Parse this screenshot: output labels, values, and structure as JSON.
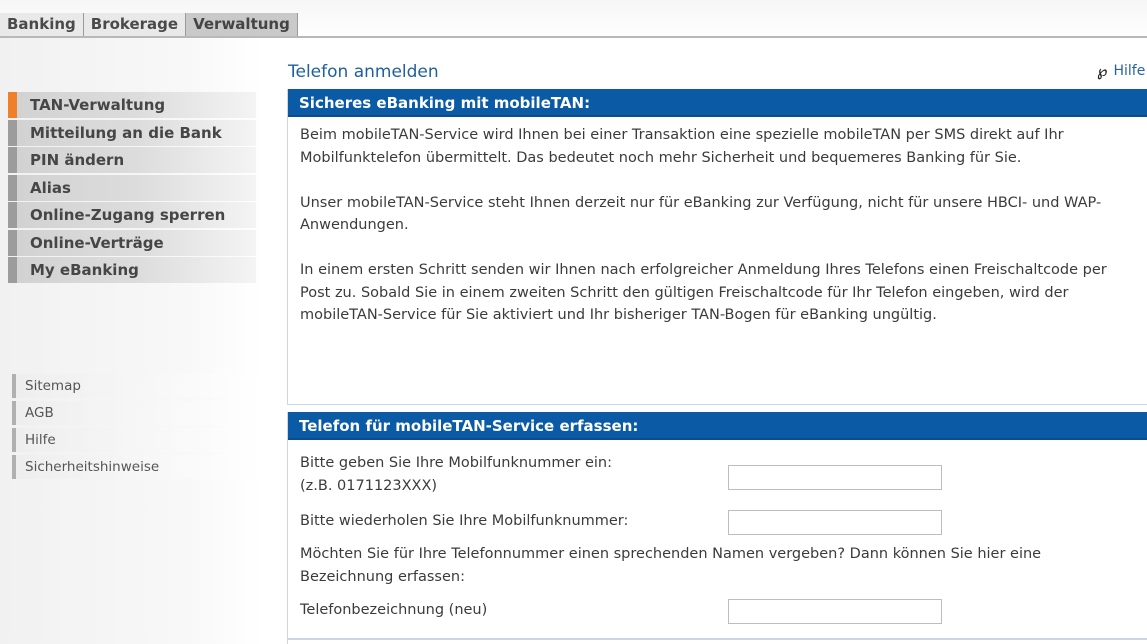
{
  "tabs": [
    {
      "label": "Banking"
    },
    {
      "label": "Brokerage"
    },
    {
      "label": "Verwaltung",
      "active": true
    }
  ],
  "sidebar": {
    "nav": [
      {
        "label": "TAN-Verwaltung",
        "active": true
      },
      {
        "label": "Mitteilung an die Bank"
      },
      {
        "label": "PIN ändern"
      },
      {
        "label": "Alias"
      },
      {
        "label": "Online-Zugang sperren"
      },
      {
        "label": "Online-Verträge"
      },
      {
        "label": "My eBanking"
      }
    ],
    "utility": [
      {
        "label": "Sitemap"
      },
      {
        "label": "AGB"
      },
      {
        "label": "Hilfe"
      },
      {
        "label": "Sicherheitshinweise"
      }
    ]
  },
  "page": {
    "title": "Telefon anmelden",
    "help_label": "Hilfe",
    "help_icon": "help-icon"
  },
  "section1": {
    "heading": "Sicheres eBanking mit mobileTAN:",
    "paragraphs": [
      "Beim mobileTAN-Service wird Ihnen bei einer Transaktion eine spezielle mobileTAN per SMS direkt auf Ihr Mobilfunktelefon übermittelt. Das bedeutet noch mehr Sicherheit und bequemeres Banking für Sie.",
      "Unser mobileTAN-Service steht Ihnen derzeit nur für eBanking zur Verfügung, nicht für unsere HBCI- und WAP-Anwendungen.",
      "In einem ersten Schritt senden wir Ihnen nach erfolgreicher Anmeldung Ihres Telefons einen Freischaltcode per Post zu. Sobald Sie in einem zweiten Schritt den gültigen Freischaltcode für Ihr Telefon eingeben, wird der mobileTAN-Service für Sie aktiviert und Ihr bisheriger TAN-Bogen für eBanking ungültig."
    ]
  },
  "section2": {
    "heading": "Telefon für mobileTAN-Service erfassen:",
    "phone_label_line1": "Bitte geben Sie Ihre Mobilfunknummer ein:",
    "phone_label_line2": "(z.B. 0171123XXX)",
    "phone_value": "",
    "repeat_label": "Bitte wiederholen Sie Ihre Mobilfunknummer:",
    "repeat_value": "",
    "name_hint": "Möchten Sie für Ihre Telefonnummer einen sprechenden Namen vergeben? Dann können Sie hier eine Bezeichnung erfassen:",
    "name_label": "Telefonbezeichnung (neu)",
    "name_value": ""
  },
  "colors": {
    "header_blue": "#0a5aa6",
    "title_blue": "#1f5fa0",
    "active_marker": "#f07f2a"
  }
}
